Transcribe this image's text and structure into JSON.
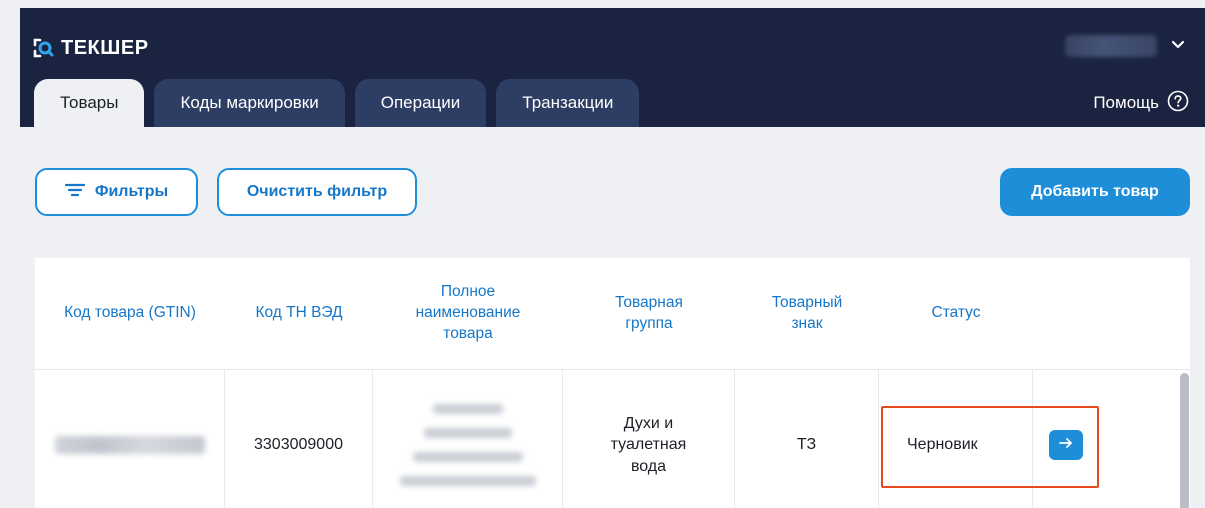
{
  "app": {
    "name": "ТЕКШЕР"
  },
  "tabs": [
    {
      "label": "Товары",
      "active": true
    },
    {
      "label": "Коды маркировки",
      "active": false
    },
    {
      "label": "Операции",
      "active": false
    },
    {
      "label": "Транзакции",
      "active": false
    }
  ],
  "help": {
    "label": "Помощь"
  },
  "toolbar": {
    "filters_label": "Фильтры",
    "clear_filter_label": "Очистить фильтр",
    "add_product_label": "Добавить товар"
  },
  "table": {
    "columns": [
      "Код товара (GTIN)",
      "Код ТН ВЭД",
      "Полное наименование товара",
      "Товарная группа",
      "Товарный знак",
      "Статус",
      ""
    ],
    "rows": [
      {
        "gtin": "",
        "tnved": "3303009000",
        "name": "",
        "group": "Духи и туалетная вода",
        "trademark": "ТЗ",
        "status": "Черновик"
      }
    ]
  },
  "colors": {
    "header_bg": "#1a2440",
    "tab_bg": "#2d3d63",
    "accent": "#1e8ed8",
    "highlight": "#e54a22"
  }
}
